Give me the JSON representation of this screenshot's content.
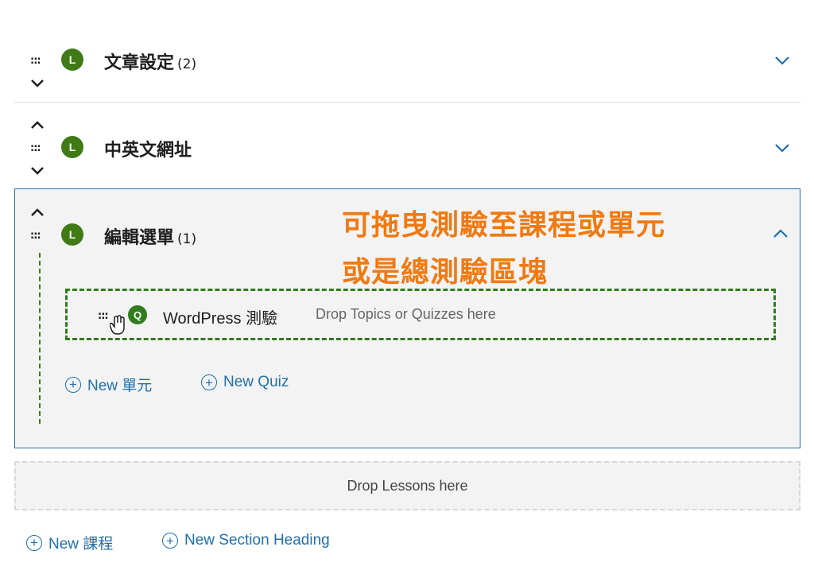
{
  "sections": [
    {
      "title": "文章設定",
      "count": "(2)"
    },
    {
      "title": "中英文網址",
      "count": ""
    },
    {
      "title": "編輯選單",
      "count": "(1)"
    }
  ],
  "lesson_badge": "L",
  "quiz_badge": "Q",
  "drag_handle": ":::",
  "annotation": {
    "line1": "可拖曳測驗至課程或單元",
    "line2": "或是總測驗區塊"
  },
  "quiz": {
    "title": "WordPress 測驗",
    "drop_hint": "Drop Topics or Quizzes here"
  },
  "section_actions": {
    "new_topic": "New 單元",
    "new_quiz": "New Quiz"
  },
  "drop_lessons": "Drop Lessons here",
  "footer_actions": {
    "new_lesson": "New 課程",
    "new_section_heading": "New Section Heading"
  },
  "plus_symbol": "+",
  "colors": {
    "badge_green": "#3f7a16",
    "link_blue": "#1f6fae",
    "annotation_orange": "#ef7a13",
    "panel_border": "#2d6fa3"
  }
}
